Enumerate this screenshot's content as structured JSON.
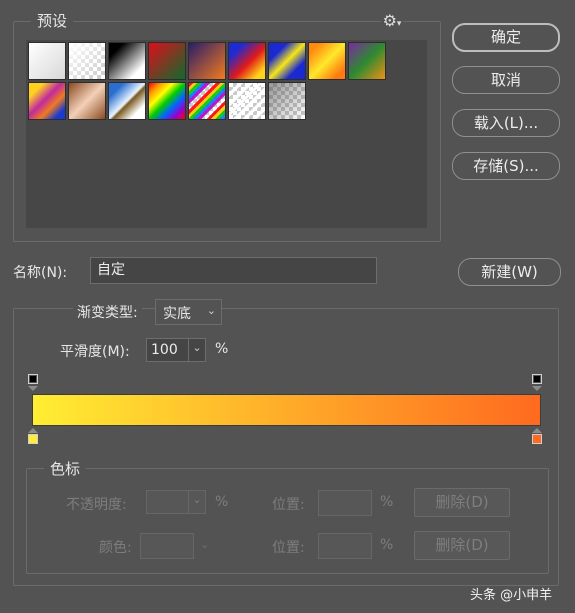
{
  "presets": {
    "legend": "预设",
    "gear_icon": "gear-icon",
    "swatches": [
      {
        "name": "gradient-white-fade",
        "bg": "linear-gradient(135deg,#ffffff,#d8d8d8)"
      },
      {
        "name": "gradient-white-transparent",
        "bg": "checker-white"
      },
      {
        "name": "gradient-black-white",
        "bg": "linear-gradient(135deg,#000 20%,#fff 80%)"
      },
      {
        "name": "gradient-red-green",
        "bg": "linear-gradient(135deg,#e00d1b,#0e6b2c)"
      },
      {
        "name": "gradient-violet-orange",
        "bg": "linear-gradient(135deg,#2a1d6b,#f27b1e)"
      },
      {
        "name": "gradient-blue-red-yellow",
        "bg": "linear-gradient(135deg,#1c2bd6 20%,#e01919 55%,#ffd31a 85%)"
      },
      {
        "name": "gradient-blue-yellow-blue",
        "bg": "linear-gradient(135deg,#1b2ad0 25%,#f5e61a 50%,#1b2ad0 75%)"
      },
      {
        "name": "gradient-orange-yellow-orange",
        "bg": "linear-gradient(135deg,#ff8a10 15%,#ffe82a 50%,#ff7a10 85%)"
      },
      {
        "name": "gradient-violet-green-orange",
        "bg": "linear-gradient(135deg,#7a2aa0,#2e8a30 50%,#f09016)"
      },
      {
        "name": "gradient-yellow-violet-orange-blue",
        "bg": "linear-gradient(135deg,#ffd020 20%,#c02aa0 45%,#f07a20 65%,#1b3ad0 85%)"
      },
      {
        "name": "gradient-copper",
        "bg": "linear-gradient(135deg,#8a4a20,#f3d0b8 50%,#8a4a20)"
      },
      {
        "name": "gradient-chrome",
        "bg": "linear-gradient(135deg,#2a6fd0 20%,#e8f4ff 50%,#7a5a20 55%,#ffffff 80%)"
      },
      {
        "name": "gradient-spectrum",
        "bg": "linear-gradient(135deg,#ff0000,#ff9900,#ffff00,#00cc00,#0066ff,#9900cc,#ff0000)"
      },
      {
        "name": "gradient-transparent-rainbow",
        "bg": "checker-rainbow"
      },
      {
        "name": "gradient-transparent-stripes",
        "bg": "checker-stripes"
      },
      {
        "name": "gradient-neutral-density",
        "bg": "checker-dark"
      }
    ]
  },
  "buttons": {
    "ok": "确定",
    "cancel": "取消",
    "load": "载入(L)...",
    "save": "存储(S)...",
    "new": "新建(W)"
  },
  "name_field": {
    "label": "名称(N):",
    "value": "自定"
  },
  "gradient": {
    "type_label": "渐变类型:",
    "type_value": "实底",
    "smoothness_label": "平滑度(M):",
    "smoothness_value": "100",
    "percent": "%",
    "colors": [
      "#ffee33",
      "#ff6a1f"
    ],
    "stop_colors": {
      "left": "#ffee33",
      "right": "#ff6a1f"
    }
  },
  "color_stops": {
    "legend": "色标",
    "opacity_label": "不透明度:",
    "opacity_unit": "%",
    "position_label": "位置:",
    "position_unit": "%",
    "delete_label": "删除(D)",
    "color_label": "颜色:",
    "position2_label": "位置:",
    "position2_unit": "%",
    "delete2_label": "删除(D)"
  },
  "watermark": "头条 @小申羊"
}
